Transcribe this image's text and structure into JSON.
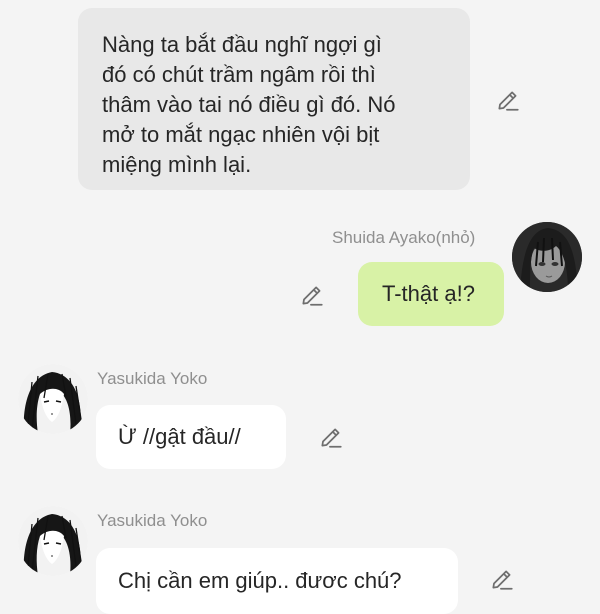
{
  "messages": [
    {
      "type": "narration",
      "text": "Nàng ta bắt đầu nghĩ ngợi gì\nđó có chút trầm ngâm rồi thì\nthâm vào tai nó điều gì đó. Nó\nmở to mắt ngạc nhiên vội bịt\nmiệng mình lại."
    },
    {
      "type": "outgoing",
      "sender": "Shuida Ayako(nhỏ)",
      "text": "T-thật ạ!?"
    },
    {
      "type": "incoming",
      "sender": "Yasukida Yoko",
      "text": "Ừ //gật đầu//"
    },
    {
      "type": "incoming",
      "sender": "Yasukida Yoko",
      "text": "Chị cần em giúp.. đươc chú?"
    }
  ],
  "icons": {
    "edit": "pencil-edit-icon"
  },
  "colors": {
    "background": "#f4f4f4",
    "narration_bubble": "#e8e8e8",
    "incoming_bubble": "#ffffff",
    "outgoing_bubble": "#d8f2a6",
    "sender_text": "#8f8f8f",
    "message_text": "#262626",
    "icon": "#6e6e6e"
  }
}
